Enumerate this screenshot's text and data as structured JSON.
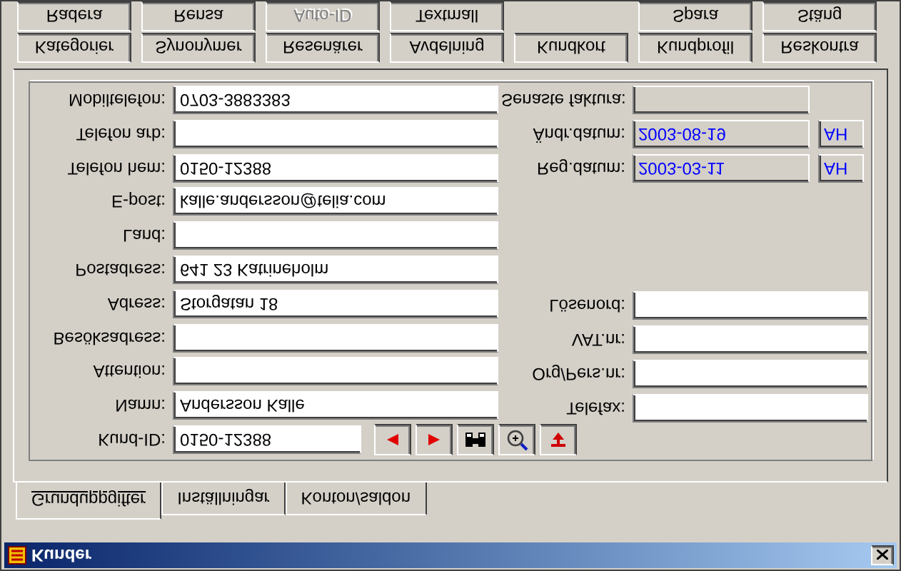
{
  "window": {
    "title": "Kunder"
  },
  "button_rows": [
    {
      "left": [
        {
          "label": "Radera",
          "disabled": false
        },
        {
          "label": "Rensa",
          "disabled": false
        },
        {
          "label": "Auto-ID",
          "disabled": true
        },
        {
          "label": "Textmall",
          "disabled": false
        }
      ],
      "right": [
        {
          "label": "Spara",
          "disabled": false
        },
        {
          "label": "Stäng",
          "disabled": false
        }
      ]
    },
    {
      "left": [
        {
          "label": "Kategorier",
          "disabled": false
        },
        {
          "label": "Synonymer",
          "disabled": false
        },
        {
          "label": "Resenärer",
          "disabled": false
        },
        {
          "label": "Avdelning",
          "disabled": false
        },
        {
          "label": "Kundkort",
          "disabled": false
        },
        {
          "label": "Kundprofil",
          "disabled": false
        },
        {
          "label": "Reskontra",
          "disabled": false
        }
      ]
    }
  ],
  "left_fields": [
    {
      "label": "Mobiltelefon:",
      "value": "0703-3883383",
      "kind": "input"
    },
    {
      "label": "Telefon arb:",
      "kind": "input"
    },
    {
      "label": "Telefon hem:",
      "value": "0150-12388",
      "kind": "input"
    },
    {
      "label": "E-post:",
      "value": "kalle.andersson@telia.com",
      "kind": "input"
    },
    {
      "label": "Land:",
      "kind": "input"
    },
    {
      "label": "Postadress:",
      "value": "641 23 Katrineholm",
      "kind": "input"
    },
    {
      "label": "Adress:",
      "value": "Storgatan 18",
      "kind": "input"
    },
    {
      "label": "Besöksadress:",
      "kind": "input"
    },
    {
      "label": "Attention:",
      "kind": "input"
    },
    {
      "label": "Namn:",
      "value": "Andersson Kalle",
      "kind": "input"
    },
    {
      "label": "Kund-ID:",
      "value": "0150-12388",
      "kind": "id"
    }
  ],
  "right_fields": [
    {
      "label": "Senaste faktura:",
      "kind": "readonly"
    },
    {
      "label": "Ändr.datum:",
      "value": "2003-08-19",
      "initials": "AH",
      "kind": "readonly"
    },
    {
      "label": "Reg.datum:",
      "value": "2003-03-11",
      "initials": "AH",
      "kind": "readonly"
    },
    {
      "label": "Lösenord:",
      "kind": "input"
    },
    {
      "label": "VAT.nr:",
      "kind": "input"
    },
    {
      "label": "Org/Pers.nr:",
      "kind": "input"
    },
    {
      "label": "Telefax:",
      "kind": "input"
    }
  ],
  "tabs": [
    {
      "label": "Grunduppgifter",
      "selected": true
    },
    {
      "label": "Inställningar",
      "selected": false
    },
    {
      "label": "Konton/saldon",
      "selected": false
    }
  ]
}
